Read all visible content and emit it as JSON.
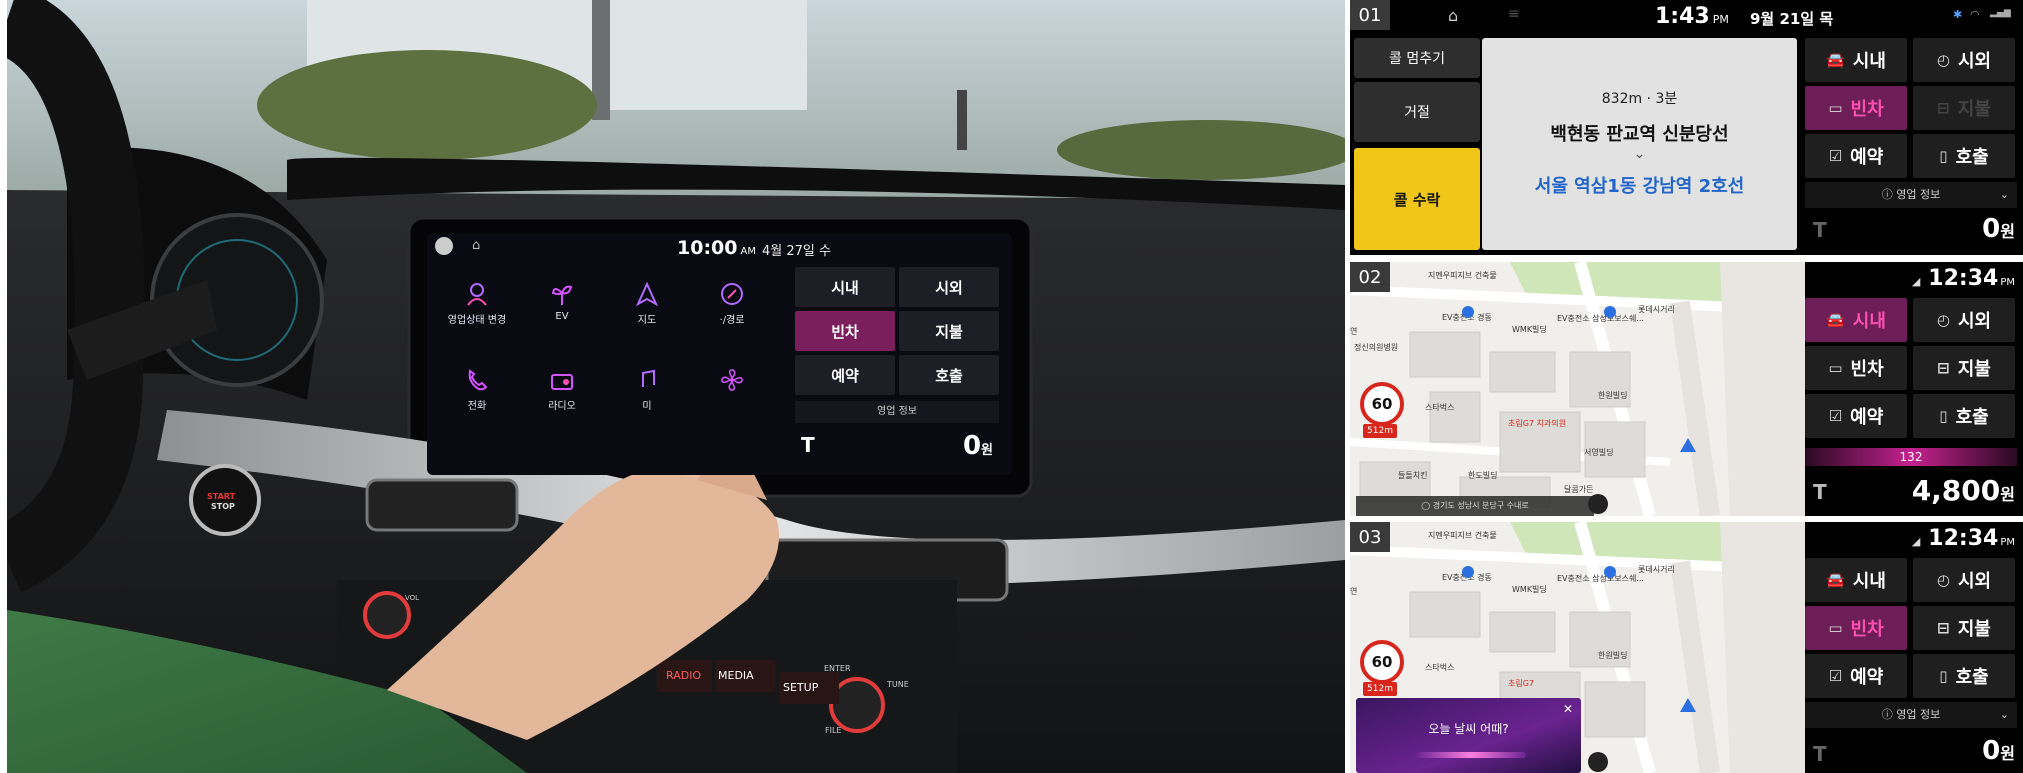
{
  "photo": {
    "head_unit": {
      "time": "10:00",
      "ampm": "AM",
      "date": "4월 27일 수",
      "apps": [
        {
          "label": "영업상태 변경",
          "icon": "person-icon"
        },
        {
          "label": "EV",
          "icon": "plant-icon"
        },
        {
          "label": "지도",
          "icon": "navigation-icon"
        },
        {
          "label": "·/경로",
          "icon": "compass-icon"
        },
        {
          "label": "전화",
          "icon": "phone-icon"
        },
        {
          "label": "라디오",
          "icon": "radio-icon"
        },
        {
          "label": "미",
          "icon": "music-icon"
        },
        {
          "label": "",
          "icon": "fan-icon"
        }
      ],
      "buttons": {
        "city": "시내",
        "suburb": "시외",
        "empty": "빈차",
        "payment": "지불",
        "reserve": "예약",
        "call": "호출"
      },
      "info": "영업 정보",
      "fare": "0",
      "fare_unit": "원",
      "t_logo": "T"
    },
    "dashboard_labels": {
      "start_stop_1": "START",
      "start_stop_2": "STOP",
      "radio": "RADIO",
      "media": "MEDIA",
      "setup": "SETUP",
      "enter": "ENTER",
      "tune": "TUNE",
      "file": "FILE",
      "vol": "VOL"
    }
  },
  "panel1": {
    "badge": "01",
    "time": "1:43",
    "ampm": "PM",
    "date": "9월 21일 목",
    "left_buttons": {
      "stop_call": "콜 멈추기",
      "reject": "거절",
      "accept": "콜 수락"
    },
    "trip": {
      "distance": "832m · 3분",
      "from": "백현동 판교역 신분당선",
      "arrow": "⌄",
      "to": "서울 역삼1동 강남역 2호선"
    },
    "buttons": {
      "city": "시내",
      "suburb": "시외",
      "empty": "빈차",
      "payment": "지불",
      "reserve": "예약",
      "call": "호출"
    },
    "info": "ⓘ 영업 정보",
    "info_chevron": "⌄",
    "t_logo": "T",
    "fare": "0",
    "fare_unit": "원"
  },
  "panel2": {
    "badge": "02",
    "time": "12:34",
    "ampm": "PM",
    "map": {
      "labels": [
        "지멘우피지브 건축물",
        "EV충전소 경동",
        "EV충전소 삼성보보스쉐...",
        "WMK빌딩",
        "롯데시거리",
        "스타벅스",
        "한원빌딩",
        "초림G7 치과의원",
        "서영빌딩",
        "들돌치킨",
        "한도빌딩",
        "달콤가든",
        "정신의원병원",
        "연"
      ],
      "speed": "60",
      "speed_sub": "512m",
      "bottom_bar": "◯ 경기도 성남시 분당구 수내로"
    },
    "buttons": {
      "city": "시내",
      "suburb": "시외",
      "empty": "빈차",
      "payment": "지불",
      "reserve": "예약",
      "call": "호출"
    },
    "meter": "132",
    "t_logo": "T",
    "fare": "4,800",
    "fare_unit": "원"
  },
  "panel3": {
    "badge": "03",
    "time": "12:34",
    "ampm": "PM",
    "map": {
      "labels": [
        "지멘우피지브 건축물",
        "EV충전소 경동",
        "EV충전소 삼성보보스쉐...",
        "WMK빌딩",
        "롯데시거리",
        "스타벅스",
        "한원빌딩",
        "초림G7",
        "연"
      ],
      "speed": "60",
      "speed_sub": "512m"
    },
    "voice": {
      "question": "오늘 날씨 어때?",
      "close": "✕"
    },
    "buttons": {
      "city": "시내",
      "suburb": "시외",
      "empty": "빈차",
      "payment": "지불",
      "reserve": "예약",
      "call": "호출"
    },
    "info": "ⓘ 영업 정보",
    "info_chevron": "⌄",
    "t_logo": "T",
    "fare": "0",
    "fare_unit": "원"
  },
  "colors": {
    "accent_pink": "#ff4fb3",
    "pink_button": "#6e1e56",
    "accept_yellow": "#f0c619",
    "link_blue": "#2266cc",
    "speed_red": "#d8261c"
  }
}
